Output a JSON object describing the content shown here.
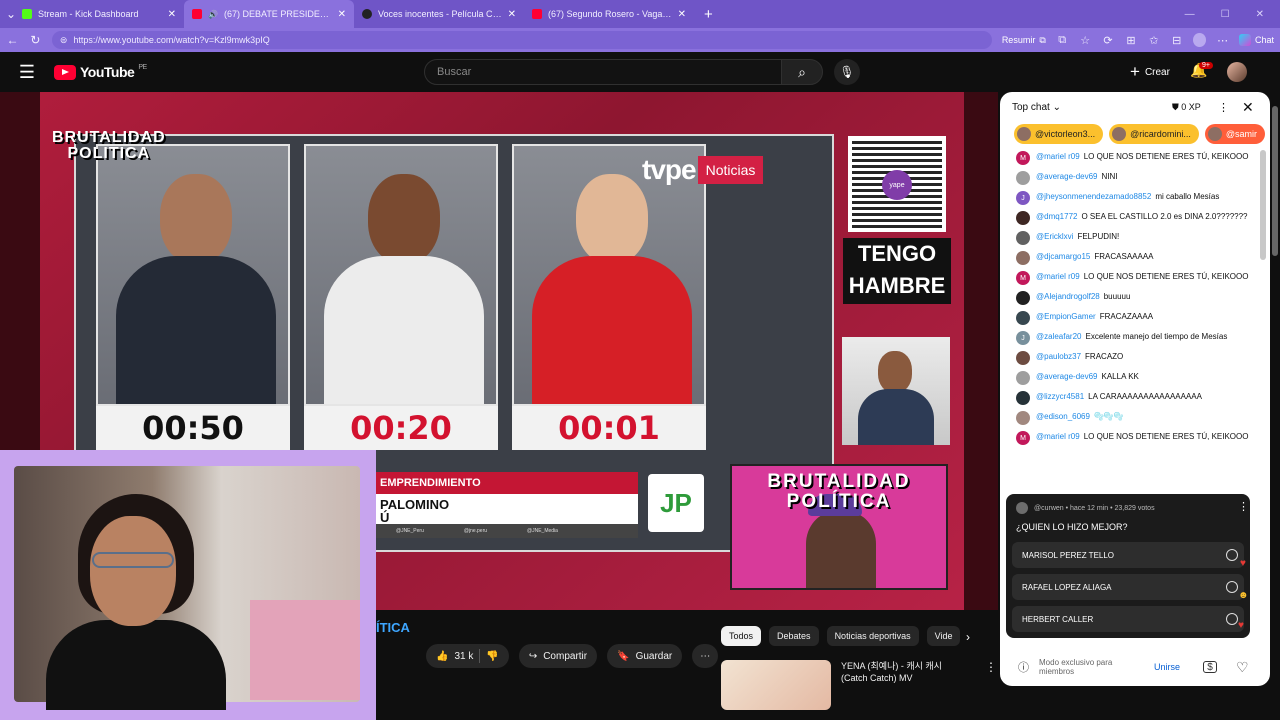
{
  "browser": {
    "tabs": [
      {
        "title": "Stream - Kick Dashboard",
        "color": "#53fc18",
        "active": false
      },
      {
        "title": "(67) DEBATE PRESIDENCIAL 2",
        "color": "#ff0033",
        "active": true
      },
      {
        "title": "Voces inocentes - Película Comple",
        "color": "#222222",
        "active": false
      },
      {
        "title": "(67) Segundo Rosero - Vagabund",
        "color": "#ff0033",
        "active": false
      }
    ],
    "url": "https://www.youtube.com/watch?v=Kzl9mwk3pIQ",
    "resumir": "Resumir",
    "chat_label": "Chat"
  },
  "youtube": {
    "logo": "YouTube",
    "country": "PE",
    "search_placeholder": "Buscar",
    "create_label": "Crear",
    "notif_count": "9+"
  },
  "video": {
    "brand_line1": "BRUTALIDAD",
    "brand_line2": "POLITICA",
    "tv_brand": "tvpe",
    "tv_news": "Noticias",
    "timers": [
      "00:50",
      "00:20",
      "00:01"
    ],
    "timer_colors": [
      "#111111",
      "#d3122f",
      "#d3122f"
    ],
    "banner_line1": "TENGO",
    "banner_line2": "HAMBRE",
    "lower_bar": "EMPRENDIMIENTO",
    "lower_name1": "PALOMINO",
    "lower_name2": "Ú",
    "socials": [
      "@JNE_Peru",
      "@jne.peru",
      "@JNE_Media"
    ],
    "party_logo": "JP",
    "pip_line1": "BRUTALIDAD",
    "pip_line2": "POLÍTICA"
  },
  "below": {
    "title_partial": "ÍTICA",
    "likes": "31 k",
    "share": "Compartir",
    "save": "Guardar",
    "chips": [
      "Todos",
      "Debates",
      "Noticias deportivas",
      "Vide"
    ],
    "rec_title": "YENA (최예나) - 캐시 캐시 (Catch Catch) MV"
  },
  "chat": {
    "header": "Top chat",
    "xp": "0 XP",
    "pins": [
      "@victorleon3...",
      "@ricardomini...",
      "@samir"
    ],
    "messages": [
      {
        "initial": "M",
        "color": "#c2185b",
        "name": "@mariel r09",
        "text": "LO QUE NOS DETIENE ERES TÚ, KEIKOOO"
      },
      {
        "initial": "",
        "color": "#9e9e9e",
        "name": "@average-dev69",
        "text": "NINI"
      },
      {
        "initial": "J",
        "color": "#7e57c2",
        "name": "@jheysonmenendezamado8852",
        "text": "mi caballo Mesías"
      },
      {
        "initial": "",
        "color": "#3e2723",
        "name": "@dmq1772",
        "text": "O SEA EL CASTILLO 2.0 es DINA 2.0???????"
      },
      {
        "initial": "",
        "color": "#616161",
        "name": "@Ericklxvi",
        "text": "FELPUDIN!"
      },
      {
        "initial": "",
        "color": "#8d6e63",
        "name": "@djcamargo15",
        "text": "FRACASAAAAA"
      },
      {
        "initial": "M",
        "color": "#c2185b",
        "name": "@mariel r09",
        "text": "LO QUE NOS DETIENE ERES TÚ, KEIKOOO"
      },
      {
        "initial": "",
        "color": "#212121",
        "name": "@Alejandrogolf28",
        "text": "buuuuu"
      },
      {
        "initial": "",
        "color": "#37474f",
        "name": "@EmpionGamer",
        "text": "FRACAZAAAA"
      },
      {
        "initial": "J",
        "color": "#78909c",
        "name": "@zaleafar20",
        "text": "Excelente manejo del tiempo de Mesías"
      },
      {
        "initial": "",
        "color": "#6d4c41",
        "name": "@paulobz37",
        "text": "FRACAZO"
      },
      {
        "initial": "",
        "color": "#9e9e9e",
        "name": "@average-dev69",
        "text": "KALLA KK"
      },
      {
        "initial": "",
        "color": "#263238",
        "name": "@lizzycr4581",
        "text": "LA CARAAAAAAAAAAAAAAAA"
      },
      {
        "initial": "",
        "color": "#a1887f",
        "name": "@edison_6069",
        "text": "🫧🫧🫧"
      },
      {
        "initial": "M",
        "color": "#c2185b",
        "name": "@mariel r09",
        "text": "LO QUE NOS DETIENE ERES TÚ, KEIKOOO"
      }
    ],
    "poll": {
      "meta": "@curwen • hace 12 min • 23,829 votos",
      "question": "¿QUIEN LO HIZO MEJOR?",
      "options": [
        "MARISOL PEREZ TELLO",
        "RAFAEL LOPEZ ALIAGA",
        "HERBERT CALLER"
      ]
    },
    "footer_text": "Modo exclusivo para miembros",
    "join": "Unirse"
  }
}
